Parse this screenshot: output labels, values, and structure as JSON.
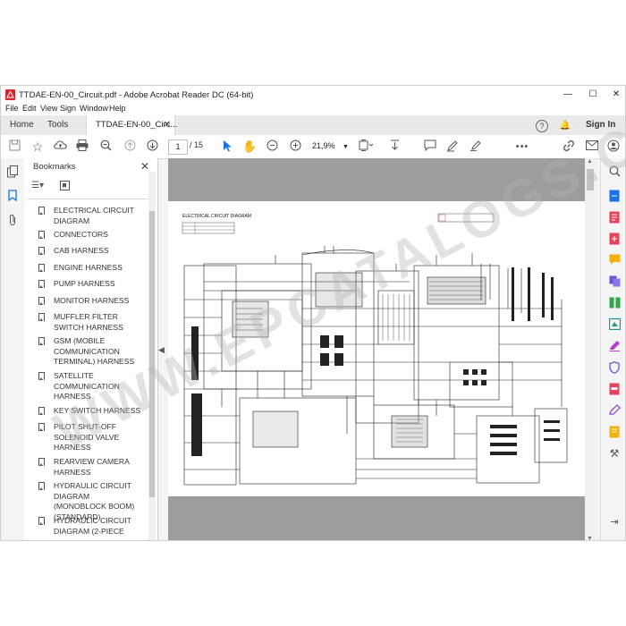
{
  "window": {
    "title": "TTDAE-EN-00_Circuit.pdf - Adobe Acrobat Reader DC (64-bit)",
    "minimize": "—",
    "maximize": "☐",
    "close": "✕"
  },
  "menu": [
    "File",
    "Edit",
    "View",
    "Sign",
    "Window",
    "Help"
  ],
  "tabs": {
    "home": "Home",
    "tools": "Tools",
    "document": "TTDAE-EN-00_Circ...",
    "document_close": "✕",
    "help_icon": "?",
    "bell_icon": "🔔",
    "sign_in": "Sign In"
  },
  "toolbar": {
    "current_page": "1",
    "total_pages": "/ 15",
    "zoom": "21,9%"
  },
  "bookmarks": {
    "header": "Bookmarks",
    "close": "✕",
    "options_icon": "☰▾",
    "items": [
      "ELECTRICAL CIRCUIT DIAGRAM",
      "CONNECTORS",
      "CAB HARNESS",
      "ENGINE HARNESS",
      "PUMP HARNESS",
      "MONITOR HARNESS",
      "MUFFLER FILTER SWITCH HARNESS",
      "GSM (MOBILE COMMUNICATION TERMINAL) HARNESS",
      "SATELLITE COMMUNICATION HARNESS",
      "KEY SWITCH HARNESS",
      "PILOT SHUT-OFF SOLENOID VALVE HARNESS",
      "REARVIEW CAMERA HARNESS",
      "HYDRAULIC CIRCUIT DIAGRAM (MONOBLOCK BOOM) (STANDARD)",
      "HYDRAULIC CIRCUIT DIAGRAM (2-PIECE"
    ]
  },
  "page": {
    "diagram_title": "ELECTRICAL CIRCUIT DIAGRAM"
  },
  "watermark": "WWW.EPCATALOGS.COM",
  "colors": {
    "accent_blue": "#1a73e8",
    "acrobat_red": "#d7262d",
    "doc_bg": "#9d9d9d"
  }
}
